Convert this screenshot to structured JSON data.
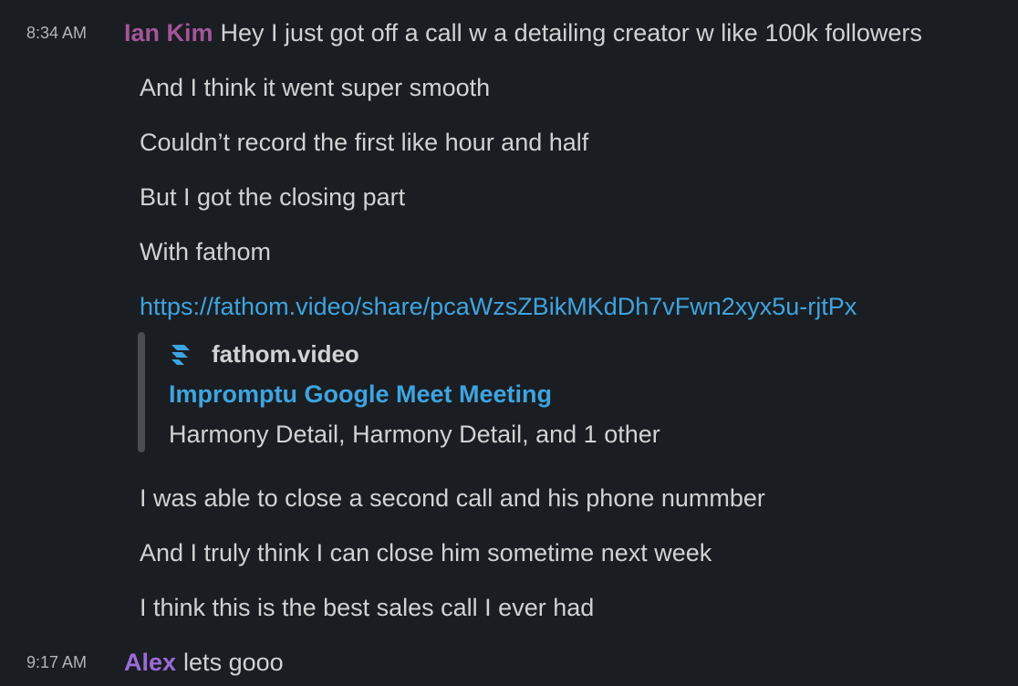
{
  "messages": [
    {
      "time": "8:34 AM",
      "user": "Ian Kim",
      "first_line": "Hey I just got off a call w a detailing creator w like 100k followers",
      "lines": [
        "And I think it went super smooth",
        "Couldn’t record the first like hour and half",
        "But I got the closing part",
        "With fathom"
      ],
      "link": "https://fathom.video/share/pcaWzsZBikMKdDh7vFwn2xyx5u-rjtPx",
      "unfurl": {
        "site": "fathom.video",
        "icon": "fathom-logo-icon",
        "title": "Impromptu Google Meet Meeting",
        "description": "Harmony Detail, Harmony Detail, and 1 other"
      },
      "after_lines": [
        "I was able to close a second call and his phone nummber",
        "And I truly think I can close him sometime next week",
        "I think this is the best sales call I ever had"
      ]
    },
    {
      "time": "9:17 AM",
      "user": "Alex",
      "first_line": "lets gooo"
    }
  ],
  "colors": {
    "background": "#1a1d21",
    "text": "#d1d2d3",
    "link": "#3ea4e0",
    "user_ian": "#a3559a",
    "user_alex": "#9c6ad9",
    "unfurl_bar": "#4a4c50"
  }
}
